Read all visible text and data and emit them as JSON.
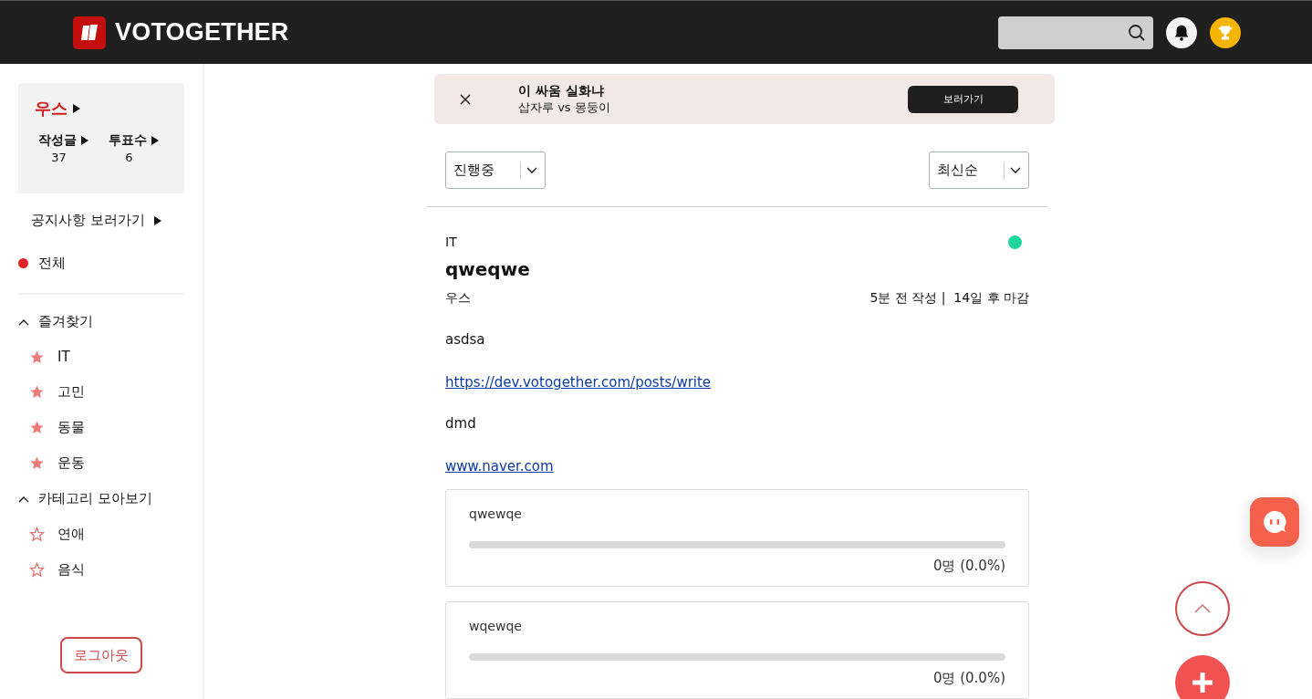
{
  "header": {
    "logo_text": "VOTOGETHER"
  },
  "sidebar": {
    "profile": {
      "nickname": "우스",
      "stats": [
        {
          "label": "작성글",
          "value": "37"
        },
        {
          "label": "투표수",
          "value": "6"
        }
      ]
    },
    "notice_link": "공지사항 보러가기",
    "all_item": {
      "label": "전체",
      "selected": true
    },
    "sections": [
      {
        "title": "즐겨찾기",
        "expanded": true,
        "items": [
          {
            "label": "IT",
            "starred": true
          },
          {
            "label": "고민",
            "starred": true
          },
          {
            "label": "동물",
            "starred": true
          },
          {
            "label": "운동",
            "starred": true
          }
        ]
      },
      {
        "title": "카테고리 모아보기",
        "expanded": true,
        "items": [
          {
            "label": "연애",
            "starred": false
          },
          {
            "label": "음식",
            "starred": false
          }
        ]
      }
    ],
    "logout": "로그아웃"
  },
  "banner": {
    "title": "이 싸움 실화냐",
    "subtitle": "삽자루 vs 몽둥이",
    "button": "보러가기"
  },
  "filters": [
    {
      "value": "진행중"
    },
    {
      "value": "최신순"
    }
  ],
  "post": {
    "category": "IT",
    "active": true,
    "title": "qweqwe",
    "author": "우스",
    "written": "5분 전 작성",
    "separator": "|",
    "deadline": "14일 후 마감",
    "body": [
      {
        "kind": "text",
        "text": "asdsa"
      },
      {
        "kind": "link",
        "text": "https://dev.votogether.com/posts/write"
      },
      {
        "kind": "text",
        "text": "dmd"
      },
      {
        "kind": "link",
        "text": "www.naver.com"
      }
    ],
    "options": [
      {
        "label": "qwewqe",
        "reading": "0명 (0.0%)"
      },
      {
        "label": "wqewqe",
        "reading": "0명 (0.0%)"
      }
    ]
  }
}
